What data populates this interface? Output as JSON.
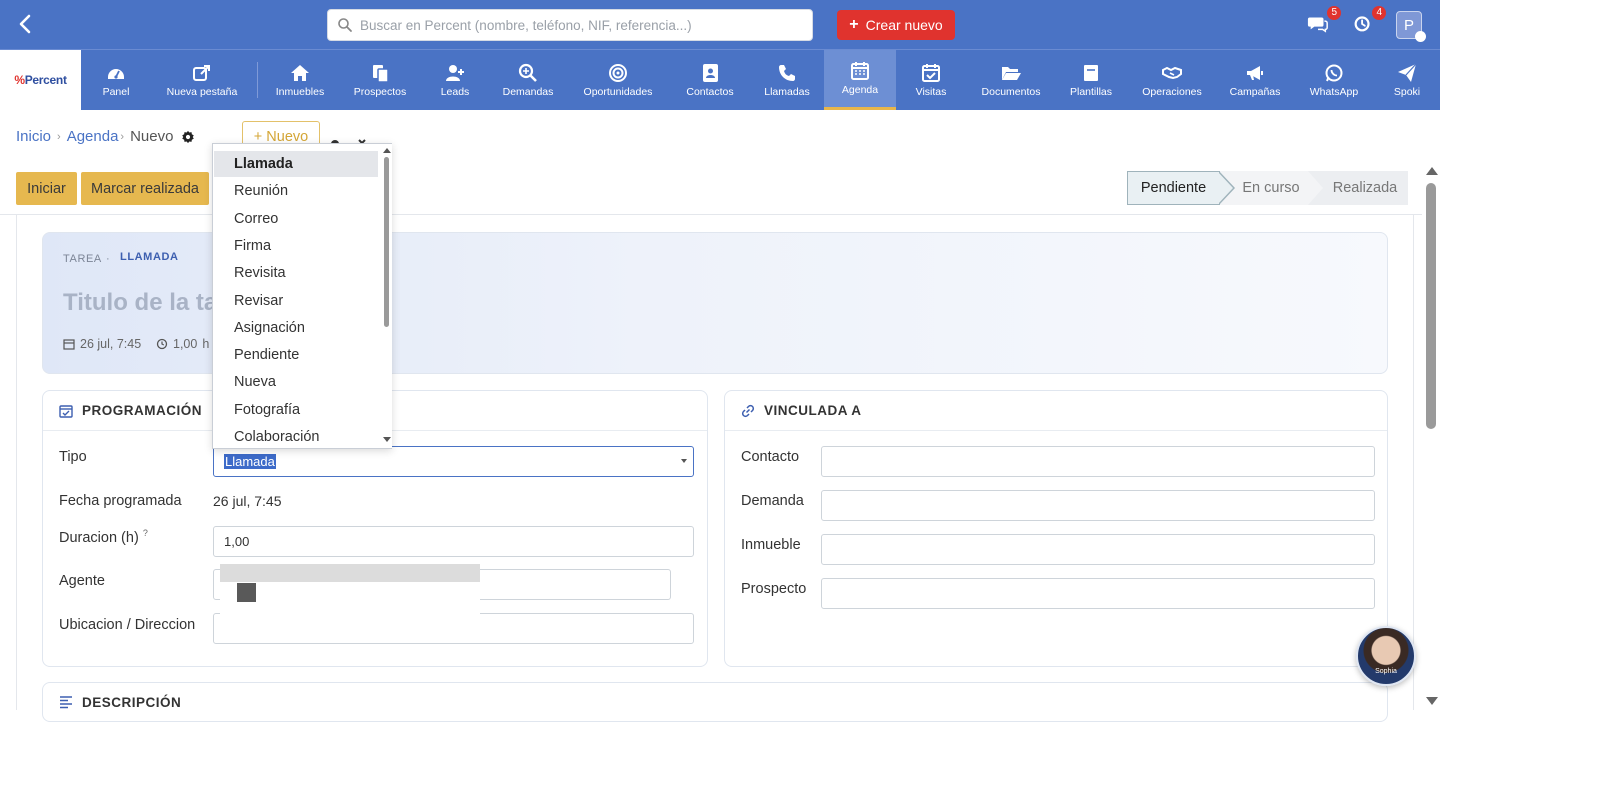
{
  "topbar": {
    "search_placeholder": "Buscar en Percent (nombre, teléfono, NIF, referencia...)",
    "crear_label": "Crear nuevo",
    "messages_count": "5",
    "notifications_count": "4",
    "avatar_initial": "P"
  },
  "nav": {
    "logo_text": "Percent",
    "items": [
      {
        "label": "Panel",
        "icon": "dashboard-icon"
      },
      {
        "label": "Nueva pestaña",
        "icon": "external-link-icon"
      },
      {
        "label": "Inmuebles",
        "icon": "home-icon"
      },
      {
        "label": "Prospectos",
        "icon": "copy-icon"
      },
      {
        "label": "Leads",
        "icon": "user-plus-icon"
      },
      {
        "label": "Demandas",
        "icon": "search-plus-icon"
      },
      {
        "label": "Oportunidades",
        "icon": "target-icon"
      },
      {
        "label": "Contactos",
        "icon": "contact-book-icon"
      },
      {
        "label": "Llamadas",
        "icon": "phone-icon"
      },
      {
        "label": "Agenda",
        "icon": "calendar-icon"
      },
      {
        "label": "Visitas",
        "icon": "calendar-check-icon"
      },
      {
        "label": "Documentos",
        "icon": "folder-open-icon"
      },
      {
        "label": "Plantillas",
        "icon": "template-icon"
      },
      {
        "label": "Operaciones",
        "icon": "handshake-icon"
      },
      {
        "label": "Campañas",
        "icon": "megaphone-icon"
      },
      {
        "label": "WhatsApp",
        "icon": "whatsapp-icon"
      },
      {
        "label": "Spoki",
        "icon": "paper-plane-icon"
      }
    ],
    "active": "Agenda"
  },
  "breadcrumb": {
    "inicio": "Inicio",
    "agenda": "Agenda",
    "current": "Nuevo"
  },
  "nuevo_button": "+ Nuevo",
  "actions": {
    "iniciar": "Iniciar",
    "marcar_realizada": "Marcar realizada"
  },
  "pipeline": [
    "Pendiente",
    "En curso",
    "Realizada"
  ],
  "hero": {
    "tag_tarea": "TAREA",
    "tag_tipo": "LLAMADA",
    "title_placeholder": "Titulo de la tarea",
    "date": "26 jul, 7:45",
    "duration": "1,00",
    "duration_unit": "h"
  },
  "programacion": {
    "title": "PROGRAMACIÓN",
    "tipo_label": "Tipo",
    "tipo_value": "Llamada",
    "fecha_label": "Fecha programada",
    "fecha_value": "26 jul, 7:45",
    "duracion_label": "Duracion (h)",
    "duracion_help": "?",
    "duracion_value": "1,00",
    "agente_label": "Agente",
    "ubicacion_label": "Ubicacion / Direccion"
  },
  "vinculada": {
    "title": "VINCULADA A",
    "contacto_label": "Contacto",
    "demanda_label": "Demanda",
    "inmueble_label": "Inmueble",
    "prospecto_label": "Prospecto"
  },
  "descripcion_title": "DESCRIPCIÓN",
  "dropdown_options": [
    "Llamada",
    "Reunión",
    "Correo",
    "Firma",
    "Revisita",
    "Revisar",
    "Asignación",
    "Pendiente",
    "Nueva",
    "Fotografía",
    "Colaboración"
  ],
  "dropdown_selected": "Llamada",
  "chat_avatar_name": "Sophia",
  "colors": {
    "brand_blue": "#4a73c5",
    "accent_red": "#e0332e",
    "action_yellow": "#e6b84f"
  }
}
